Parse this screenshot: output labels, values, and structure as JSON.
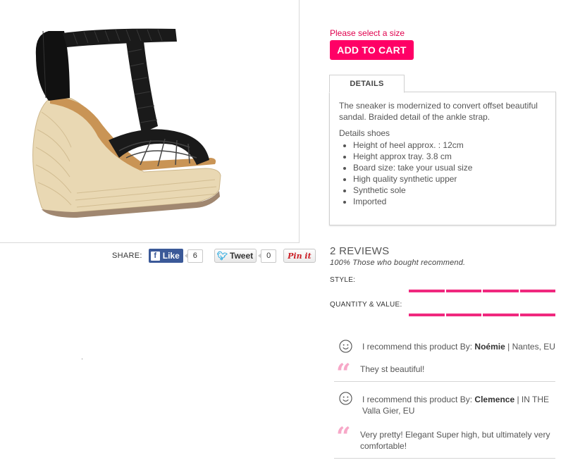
{
  "product": {
    "image_alt": "black braided wedge sandal"
  },
  "share": {
    "label": "SHARE:",
    "like_label": "Like",
    "like_count": "6",
    "tweet_label": "Tweet",
    "tweet_count": "0",
    "pin_label": "Pin it"
  },
  "purchase": {
    "size_warning": "Please select a size",
    "add_to_cart_label": "ADD TO CART"
  },
  "details": {
    "tab_label": "DETAILS",
    "description": "The sneaker is modernized to convert offset beautiful sandal. Braided detail of the ankle strap.",
    "heading": "Details shoes",
    "items": [
      "Height of heel approx. : 12cm",
      "Height approx tray. 3.8 cm",
      "Board size: take your usual size",
      "High quality synthetic upper",
      "Synthetic sole",
      "Imported"
    ]
  },
  "reviews": {
    "title": "2 REVIEWS",
    "summary": "100% Those who bought recommend.",
    "ratings": [
      {
        "label": "STYLE:",
        "segments_filled": 4,
        "segments_total": 4
      },
      {
        "label": "QUANTITY & VALUE:",
        "segments_filled": 4,
        "segments_total": 4
      }
    ],
    "bar_color": "#f0287e",
    "items": [
      {
        "recommend_text": "I recommend this product By:",
        "author": "Noémie",
        "location": "| Nantes, EU",
        "text": "They st beautiful!"
      },
      {
        "recommend_text": "I recommend this product By:",
        "author": "Clemence",
        "location": "| IN THE Valla Gier, EU",
        "text": "Very pretty! Elegant Super high, but ultimately very comfortable!"
      }
    ]
  },
  "colors": {
    "accent": "#ff0066",
    "warning": "#e0004d",
    "facebook": "#3b5998"
  }
}
